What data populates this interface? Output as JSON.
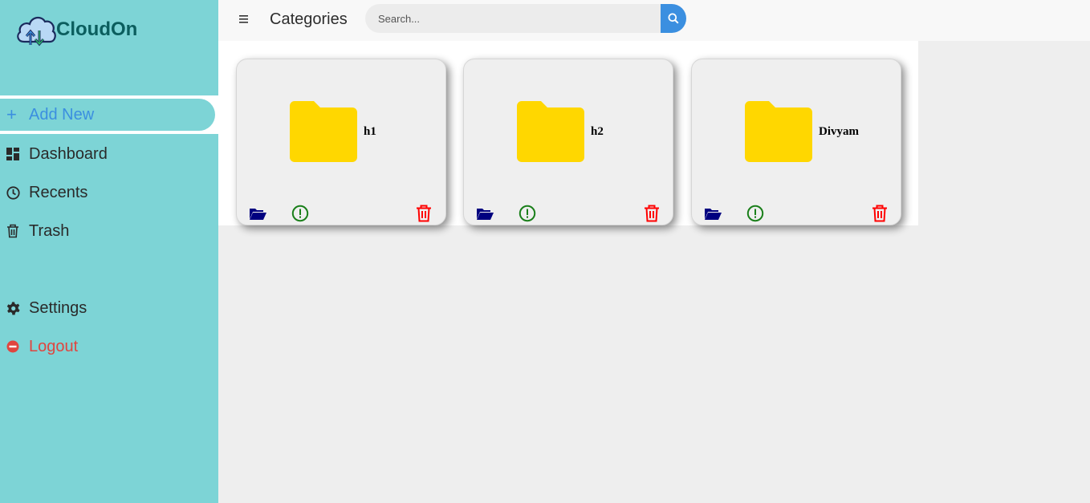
{
  "brand": {
    "name": "CloudOn"
  },
  "sidebar": {
    "add_new": {
      "label": "Add New",
      "icon": "plus-icon"
    },
    "items": [
      {
        "label": "Dashboard",
        "icon": "dashboard-icon"
      },
      {
        "label": "Recents",
        "icon": "clock-icon"
      },
      {
        "label": "Trash",
        "icon": "trash-icon"
      },
      {
        "label": "Settings",
        "icon": "gear-icon"
      },
      {
        "label": "Logout",
        "icon": "logout-icon"
      }
    ]
  },
  "header": {
    "title": "Categories",
    "search": {
      "placeholder": "Search...",
      "value": ""
    }
  },
  "folders": [
    {
      "name": "h1"
    },
    {
      "name": "h2"
    },
    {
      "name": "Divyam"
    }
  ],
  "colors": {
    "sidebar": "#7dd4d6",
    "accent": "#3b8fe0",
    "folder": "#ffd700",
    "open_icon": "#000080",
    "info_icon": "#1a7f1a",
    "delete_icon": "#ff0000",
    "logout": "#e0453f"
  }
}
